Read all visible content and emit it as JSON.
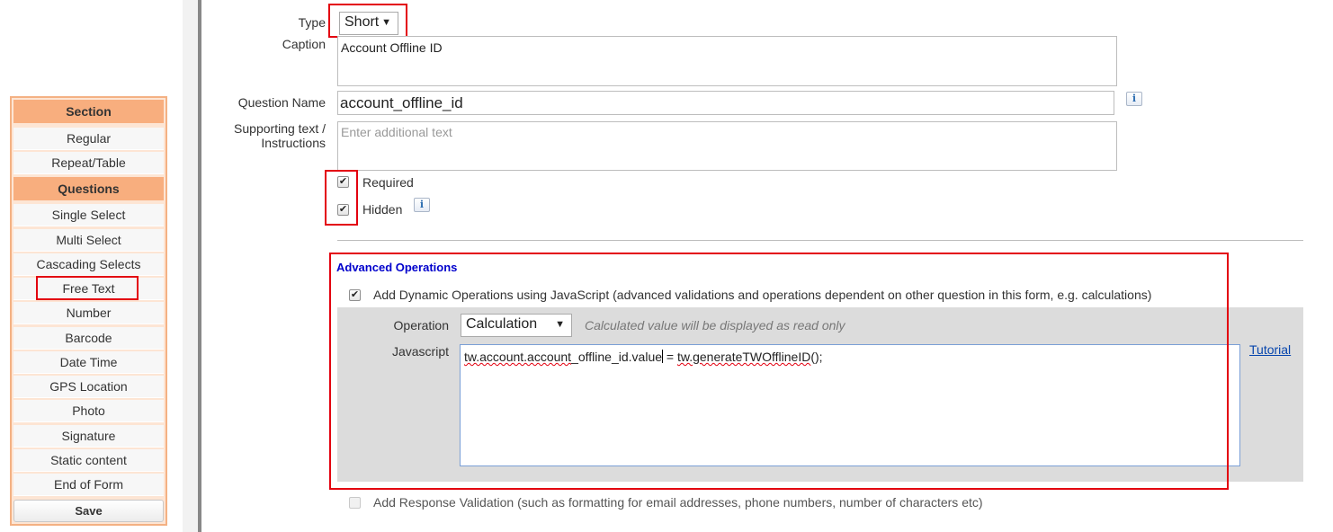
{
  "palette": {
    "section_header": "Section",
    "section_items": [
      "Regular",
      "Repeat/Table"
    ],
    "questions_header": "Questions",
    "question_items": [
      "Single Select",
      "Multi Select",
      "Cascading Selects",
      "Free Text",
      "Number",
      "Barcode",
      "Date Time",
      "GPS Location",
      "Photo",
      "Signature",
      "Static content",
      "End of Form"
    ],
    "save_label": "Save"
  },
  "form": {
    "type_label": "Type",
    "type_value": "Short",
    "caption_label": "Caption",
    "caption_value": "Account Offline ID",
    "question_name_label": "Question Name",
    "question_name_value": "account_offline_id",
    "supporting_label_line1": "Supporting text /",
    "supporting_label_line2": "Instructions",
    "supporting_placeholder": "Enter additional text",
    "required_label": "Required",
    "required_checked": true,
    "hidden_label": "Hidden",
    "hidden_checked": true,
    "info_glyph": "i"
  },
  "advanced": {
    "title": "Advanced Operations",
    "dynamic_ops_label": "Add Dynamic Operations using JavaScript (advanced validations and operations dependent on other question in this form, e.g. calculations)",
    "dynamic_ops_checked": true,
    "operation_label": "Operation",
    "operation_value": "Calculation",
    "operation_hint": "Calculated value will be displayed as read only",
    "javascript_label": "Javascript",
    "js_part1": "tw.account.account",
    "js_part2": "_offline_id",
    "js_part3": ".value",
    "js_part4": " = ",
    "js_part5": "tw.generateTWOfflineID",
    "js_part6": "();",
    "tutorial_label": "Tutorial",
    "response_validation_label": "Add Response Validation (such as formatting for email addresses, phone numbers, number of characters etc)",
    "response_validation_checked": false
  },
  "colors": {
    "palette_border": "#f4b183",
    "palette_header": "#f8ae7e",
    "highlight_red": "#e3000f",
    "advanced_title": "#0000cc",
    "link_blue": "#0645ad"
  }
}
